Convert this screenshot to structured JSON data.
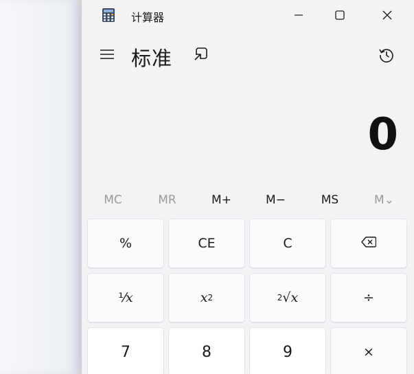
{
  "window": {
    "title": "计算器",
    "controls": {
      "minimize": "minimize-icon",
      "maximize": "maximize-icon",
      "close": "close-icon"
    }
  },
  "header": {
    "mode_title": "标准",
    "icons": [
      "hamburger-menu-icon",
      "keep-on-top-icon",
      "history-icon"
    ]
  },
  "display": {
    "value": "0"
  },
  "memory": {
    "buttons": [
      {
        "label": "MC",
        "enabled": false
      },
      {
        "label": "MR",
        "enabled": false
      },
      {
        "label": "M+",
        "enabled": true
      },
      {
        "label": "M−",
        "enabled": true
      },
      {
        "label": "MS",
        "enabled": true
      },
      {
        "label": "M⌄",
        "enabled": false
      }
    ]
  },
  "keys": {
    "row1": [
      "%",
      "CE",
      "C",
      "backspace-icon"
    ],
    "row2": {
      "reciprocal": "⅟",
      "reciprocal_var": "x",
      "square_var": "x",
      "square_exp": "2",
      "sqrt_idx": "2",
      "sqrt_sym": "√",
      "sqrt_var": "x",
      "divide": "÷"
    },
    "row3": [
      "7",
      "8",
      "9",
      "×"
    ]
  },
  "colors": {
    "window_bg": "#f3f3f6",
    "key_bg": "#fbfbfd",
    "number_key_bg": "#ffffff",
    "text": "#1a1a1a",
    "disabled_text": "#9a9a9a"
  }
}
